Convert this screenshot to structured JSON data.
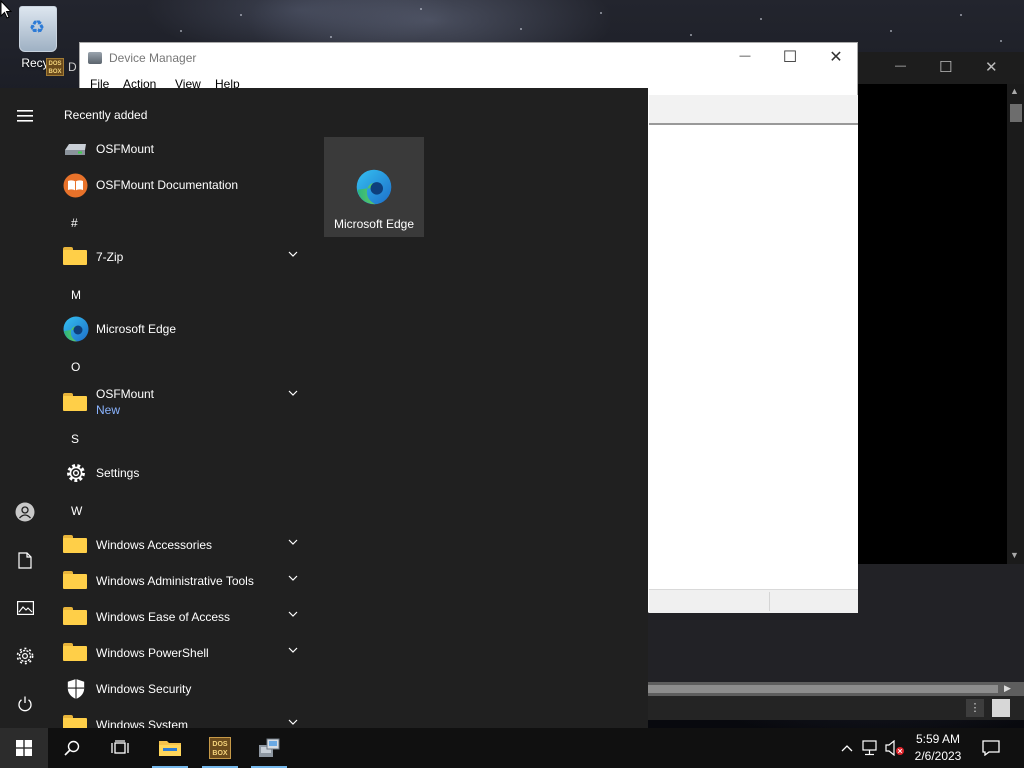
{
  "desktop": {
    "recycle_bin_label": "Recyc",
    "dosbox_label": "D",
    "dosbox_badge": "DOS BOX"
  },
  "device_manager": {
    "title": "Device Manager",
    "menu": [
      "File",
      "Action",
      "View",
      "Help"
    ],
    "controls": {
      "minimize": "—",
      "maximize": "☐",
      "close": "✕"
    }
  },
  "background_window": {
    "controls": {
      "minimize": "—",
      "maximize": "☐",
      "close": "✕"
    }
  },
  "start_menu": {
    "recently_added_label": "Recently added",
    "recently_added": [
      {
        "label": "OSFMount",
        "icon": "drive-icon"
      },
      {
        "label": "OSFMount Documentation",
        "icon": "book-icon"
      }
    ],
    "groups": [
      {
        "letter": "#",
        "items": [
          {
            "label": "7-Zip",
            "icon": "folder-icon",
            "expandable": true
          }
        ]
      },
      {
        "letter": "M",
        "items": [
          {
            "label": "Microsoft Edge",
            "icon": "edge-icon",
            "expandable": false
          }
        ]
      },
      {
        "letter": "O",
        "items": [
          {
            "label": "OSFMount",
            "sublabel": "New",
            "icon": "folder-icon",
            "expandable": true
          }
        ]
      },
      {
        "letter": "S",
        "items": [
          {
            "label": "Settings",
            "icon": "gear-icon",
            "expandable": false
          }
        ]
      },
      {
        "letter": "W",
        "items": [
          {
            "label": "Windows Accessories",
            "icon": "folder-icon",
            "expandable": true
          },
          {
            "label": "Windows Administrative Tools",
            "icon": "folder-icon",
            "expandable": true
          },
          {
            "label": "Windows Ease of Access",
            "icon": "folder-icon",
            "expandable": true
          },
          {
            "label": "Windows PowerShell",
            "icon": "folder-icon",
            "expandable": true
          },
          {
            "label": "Windows Security",
            "icon": "shield-icon",
            "expandable": false
          },
          {
            "label": "Windows System",
            "icon": "folder-icon",
            "expandable": true
          }
        ]
      }
    ],
    "pinned_tile": {
      "label": "Microsoft Edge",
      "icon": "edge-icon"
    },
    "rail_icons": [
      "hamburger-menu-icon",
      "user-icon",
      "documents-icon",
      "pictures-icon",
      "settings-gear-icon",
      "power-icon"
    ]
  },
  "taskbar": {
    "buttons": [
      "windows-start-icon",
      "search-icon",
      "task-view-icon",
      "file-explorer-icon",
      "dosbox-icon",
      "device-manager-icon"
    ],
    "tray_icons": [
      "chevron-up-icon",
      "network-icon",
      "volume-muted-icon"
    ],
    "time": "5:59 AM",
    "date": "2/6/2023",
    "notification_icon": "action-center-icon"
  },
  "colors": {
    "start_bg": "#202020",
    "taskbar_bg": "#101010",
    "accent_new": "#8ab4ff",
    "folder_yellow": "#ffcf48",
    "tile_bg": "#3a3a3a"
  }
}
